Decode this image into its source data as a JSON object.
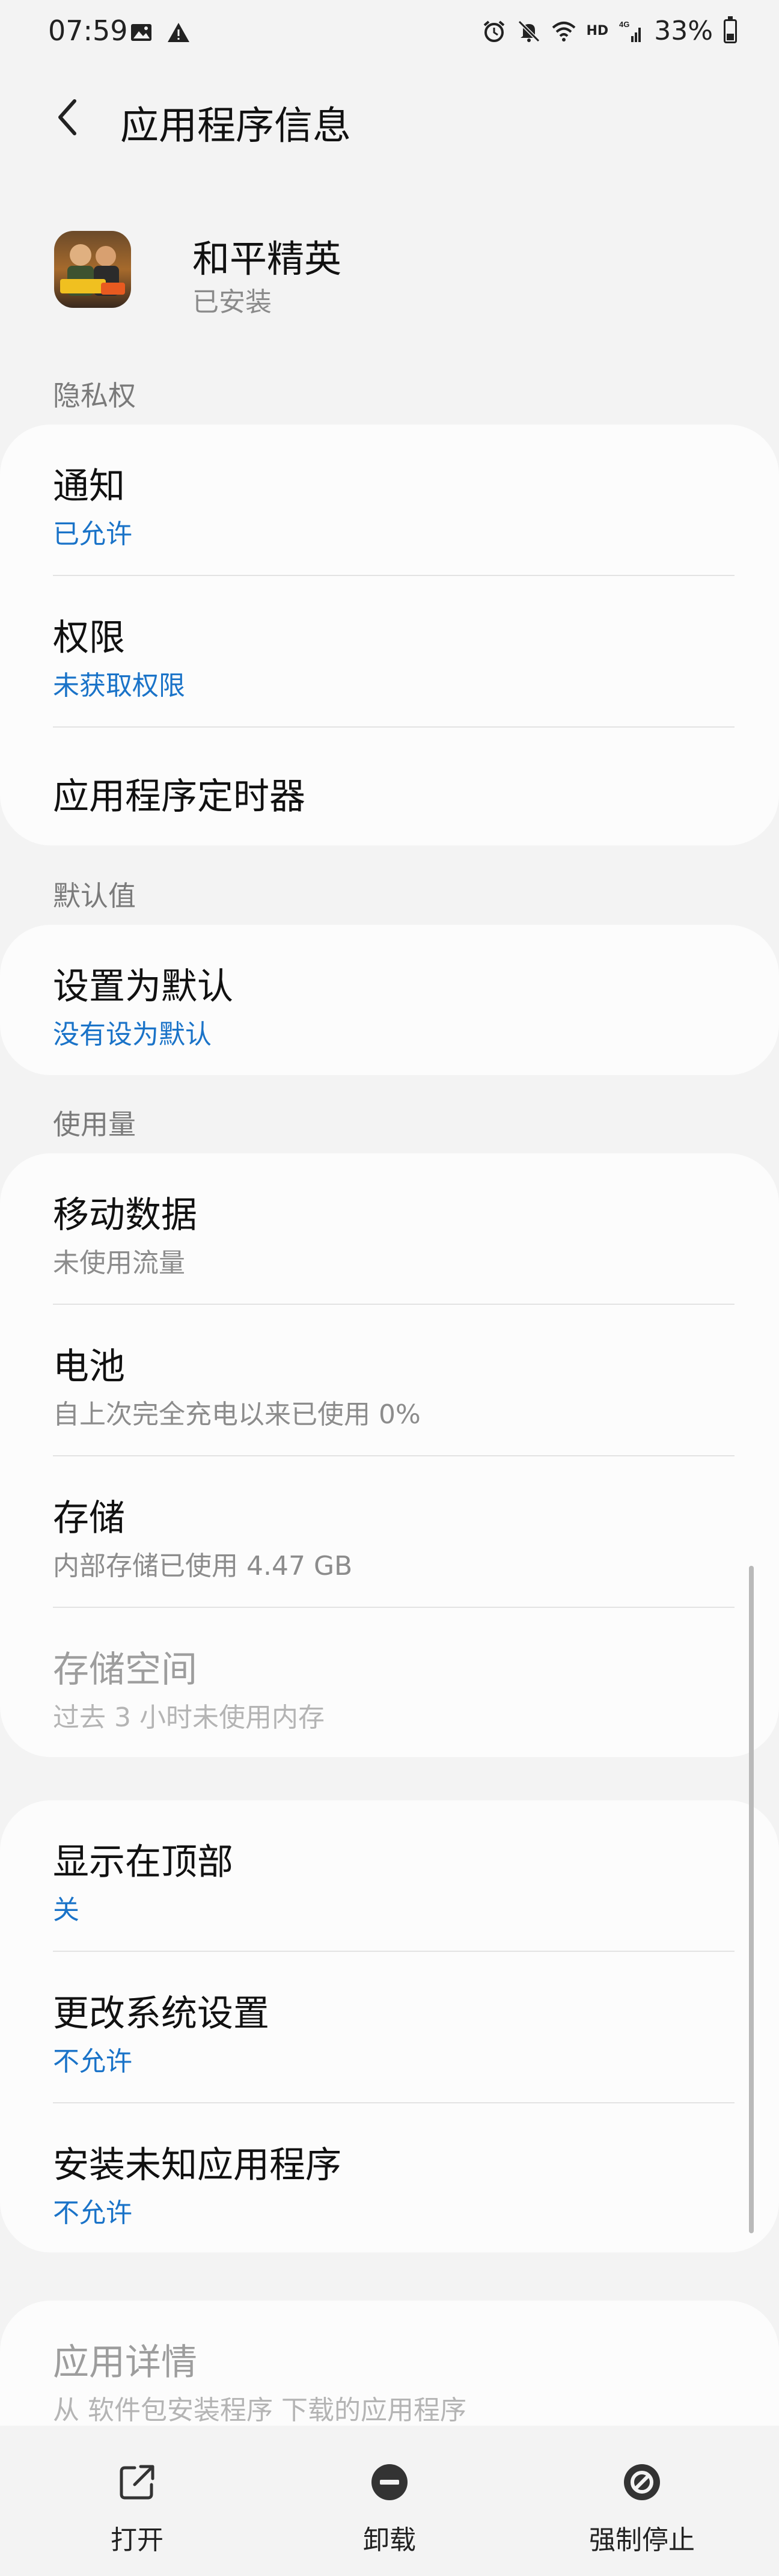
{
  "status_bar": {
    "time": "07:59",
    "battery": "33%",
    "network": "4G",
    "hd": "HD"
  },
  "header": {
    "title": "应用程序信息"
  },
  "app": {
    "name": "和平精英",
    "status": "已安装"
  },
  "sections": {
    "privacy": {
      "label": "隐私权",
      "items": [
        {
          "title": "通知",
          "subtitle": "已允许"
        },
        {
          "title": "权限",
          "subtitle": "未获取权限"
        },
        {
          "title": "应用程序定时器"
        }
      ]
    },
    "defaults": {
      "label": "默认值",
      "items": [
        {
          "title": "设置为默认",
          "subtitle": "没有设为默认"
        }
      ]
    },
    "usage": {
      "label": "使用量",
      "items": [
        {
          "title": "移动数据",
          "subtitle": "未使用流量"
        },
        {
          "title": "电池",
          "subtitle": "自上次完全充电以来已使用 0%"
        },
        {
          "title": "存储",
          "subtitle": "内部存储已使用 4.47 GB"
        },
        {
          "title": "存储空间",
          "subtitle": "过去 3 小时未使用内存"
        }
      ]
    },
    "advanced": {
      "items": [
        {
          "title": "显示在顶部",
          "subtitle": "关"
        },
        {
          "title": "更改系统设置",
          "subtitle": "不允许"
        },
        {
          "title": "安装未知应用程序",
          "subtitle": "不允许"
        }
      ]
    },
    "details": {
      "items": [
        {
          "title": "应用详情",
          "subtitle": "从 软件包安装程序 下载的应用程序"
        }
      ]
    }
  },
  "bottom_bar": {
    "open": "打开",
    "uninstall": "卸载",
    "force_stop": "强制停止"
  },
  "colors": {
    "link_blue": "#1a73c8",
    "background": "#f3f3f3",
    "card": "#fcfcfc"
  }
}
